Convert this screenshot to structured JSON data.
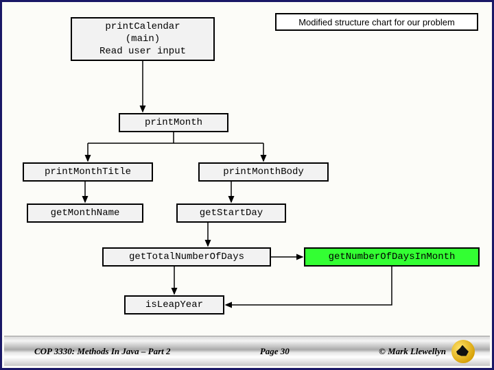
{
  "header": {
    "title": "Modified structure chart for our problem"
  },
  "nodes": {
    "root_l1": "printCalendar",
    "root_l2": "(main)",
    "root_l3": "Read user input",
    "printMonth": "printMonth",
    "printMonthTitle": "printMonthTitle",
    "printMonthBody": "printMonthBody",
    "getMonthName": "getMonthName",
    "getStartDay": "getStartDay",
    "getTotalNumberOfDays": "getTotalNumberOfDays",
    "getNumberOfDaysInMonth": "getNumberOfDaysInMonth",
    "isLeapYear": "isLeapYear"
  },
  "footer": {
    "left": "COP 3330: Methods In Java – Part 2",
    "center": "Page 30",
    "right": "© Mark Llewellyn"
  },
  "chart_data": {
    "type": "tree",
    "title": "Modified structure chart for our problem",
    "nodes": [
      {
        "id": "printCalendar",
        "label": "printCalendar (main) Read user input",
        "highlighted": false
      },
      {
        "id": "printMonth",
        "label": "printMonth",
        "highlighted": false
      },
      {
        "id": "printMonthTitle",
        "label": "printMonthTitle",
        "highlighted": false
      },
      {
        "id": "printMonthBody",
        "label": "printMonthBody",
        "highlighted": false
      },
      {
        "id": "getMonthName",
        "label": "getMonthName",
        "highlighted": false
      },
      {
        "id": "getStartDay",
        "label": "getStartDay",
        "highlighted": false
      },
      {
        "id": "getTotalNumberOfDays",
        "label": "getTotalNumberOfDays",
        "highlighted": false
      },
      {
        "id": "getNumberOfDaysInMonth",
        "label": "getNumberOfDaysInMonth",
        "highlighted": true
      },
      {
        "id": "isLeapYear",
        "label": "isLeapYear",
        "highlighted": false
      }
    ],
    "edges": [
      {
        "from": "printCalendar",
        "to": "printMonth"
      },
      {
        "from": "printMonth",
        "to": "printMonthTitle"
      },
      {
        "from": "printMonth",
        "to": "printMonthBody"
      },
      {
        "from": "printMonthTitle",
        "to": "getMonthName"
      },
      {
        "from": "printMonthBody",
        "to": "getStartDay"
      },
      {
        "from": "getStartDay",
        "to": "getTotalNumberOfDays"
      },
      {
        "from": "getTotalNumberOfDays",
        "to": "getNumberOfDaysInMonth"
      },
      {
        "from": "getTotalNumberOfDays",
        "to": "isLeapYear"
      },
      {
        "from": "getNumberOfDaysInMonth",
        "to": "isLeapYear"
      }
    ]
  }
}
